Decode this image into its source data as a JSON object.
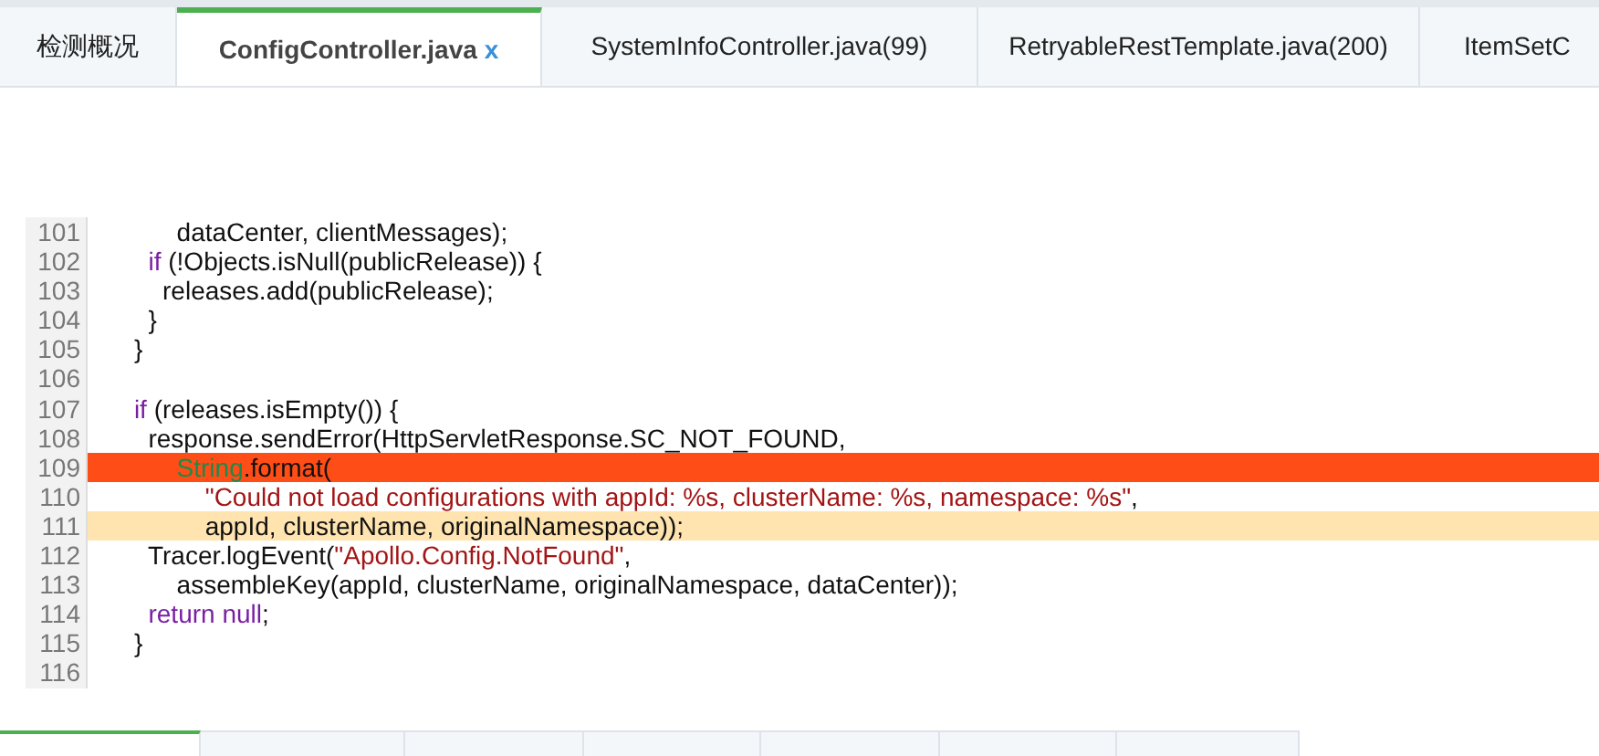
{
  "tabs": [
    {
      "label": "检测概况",
      "selected": false
    },
    {
      "label": "ConfigController.java",
      "close": "x",
      "selected": true
    },
    {
      "label": "SystemInfoController.java(99)",
      "selected": false
    },
    {
      "label": "RetryableRestTemplate.java(200)",
      "selected": false
    },
    {
      "label": "ItemSetC",
      "selected": false
    }
  ],
  "code_lines": [
    {
      "number": "101",
      "kind": "normal",
      "segments": [
        {
          "kind": "plain",
          "text": "           dataCenter, clientMessages);"
        }
      ]
    },
    {
      "number": "102",
      "kind": "normal",
      "segments": [
        {
          "kind": "keyword",
          "text": "       if"
        },
        {
          "kind": "plain",
          "text": " (!Objects.isNull(publicRelease)) {"
        }
      ]
    },
    {
      "number": "103",
      "kind": "normal",
      "segments": [
        {
          "kind": "plain",
          "text": "         releases.add(publicRelease);"
        }
      ]
    },
    {
      "number": "104",
      "kind": "normal",
      "segments": [
        {
          "kind": "plain",
          "text": "       }"
        }
      ]
    },
    {
      "number": "105",
      "kind": "normal",
      "segments": [
        {
          "kind": "plain",
          "text": "     }"
        }
      ]
    },
    {
      "number": "106",
      "kind": "normal"
    },
    {
      "number": "107",
      "kind": "normal",
      "segments": [
        {
          "kind": "keyword",
          "text": "     if"
        },
        {
          "kind": "plain",
          "text": " (releases.isEmpty()) {"
        }
      ]
    },
    {
      "number": "108",
      "kind": "normal",
      "segments": [
        {
          "kind": "plain",
          "text": "       response.sendError(HttpServletResponse.SC_NOT_FOUND,"
        }
      ]
    },
    {
      "number": "109",
      "kind": "error",
      "segments": [
        {
          "kind": "type",
          "text": "           String"
        },
        {
          "kind": "plain",
          "text": ".format("
        }
      ]
    },
    {
      "number": "110",
      "kind": "normal",
      "segments": [
        {
          "kind": "string",
          "text": "               \"Could not load configurations with appId: %s, clusterName: %s, namespace: %s\""
        },
        {
          "kind": "plain",
          "text": ","
        }
      ]
    },
    {
      "number": "111",
      "kind": "warning",
      "segments": [
        {
          "kind": "plain",
          "text": "               appId, clusterName, originalNamespace));"
        }
      ]
    },
    {
      "number": "112",
      "kind": "normal",
      "segments": [
        {
          "kind": "plain",
          "text": "       Tracer.logEvent("
        },
        {
          "kind": "string",
          "text": "\"Apollo.Config.NotFound\""
        },
        {
          "kind": "plain",
          "text": ","
        }
      ]
    },
    {
      "number": "113",
      "kind": "normal",
      "segments": [
        {
          "kind": "plain",
          "text": "           assembleKey(appId, clusterName, originalNamespace, dataCenter));"
        }
      ]
    },
    {
      "number": "114",
      "kind": "normal",
      "segments": [
        {
          "kind": "keyword",
          "text": "       return null"
        },
        {
          "kind": "plain",
          "text": ";"
        }
      ]
    },
    {
      "number": "115",
      "kind": "normal",
      "segments": [
        {
          "kind": "plain",
          "text": "     }"
        }
      ]
    },
    {
      "number": "116",
      "kind": "normal"
    }
  ],
  "bottom_tabs": [
    {
      "selected": true
    },
    {
      "selected": false
    },
    {
      "selected": false
    },
    {
      "selected": false
    },
    {
      "selected": false
    },
    {
      "selected": false
    },
    {
      "selected": false
    }
  ]
}
